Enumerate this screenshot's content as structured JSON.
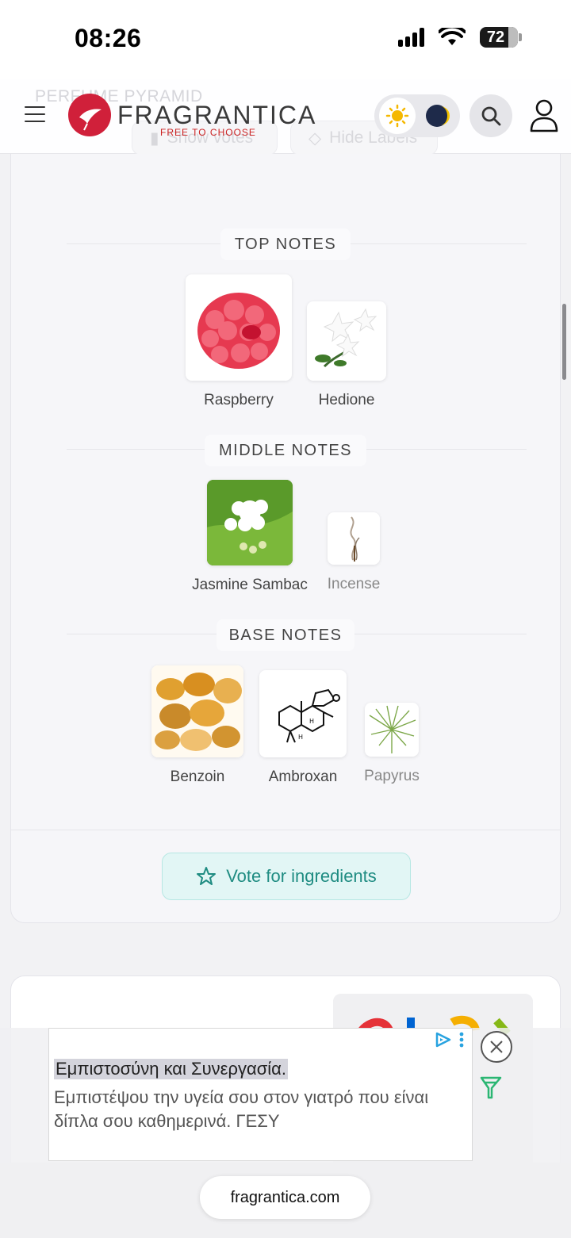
{
  "status_bar": {
    "time": "08:26",
    "battery": "72"
  },
  "header": {
    "ghost_title": "PERFUME PYRAMID",
    "ghost_show_votes": "Show votes",
    "ghost_hide_labels": "Hide Labels",
    "logo_text": "FRAGRANTICA",
    "logo_tagline": "FREE TO CHOOSE"
  },
  "pyramid": {
    "top": {
      "label": "TOP NOTES",
      "notes": [
        {
          "name": "Raspberry",
          "icon": "raspberry-icon"
        },
        {
          "name": "Hedione",
          "icon": "jasmine-flower-icon"
        }
      ]
    },
    "middle": {
      "label": "MIDDLE NOTES",
      "notes": [
        {
          "name": "Jasmine Sambac",
          "icon": "jasmine-sambac-icon"
        },
        {
          "name": "Incense",
          "icon": "incense-icon"
        }
      ]
    },
    "base": {
      "label": "BASE NOTES",
      "notes": [
        {
          "name": "Benzoin",
          "icon": "benzoin-resin-icon"
        },
        {
          "name": "Ambroxan",
          "icon": "molecule-icon"
        },
        {
          "name": "Papyrus",
          "icon": "papyrus-plant-icon"
        }
      ]
    }
  },
  "vote_button": {
    "label": "Vote for ingredients"
  },
  "ad": {
    "headline": "Εμπιστοσύνη και Συνεργασία.",
    "body": "Εμπιστέψου την υγεία σου στον γιατρό που είναι δίπλα σου καθημερινά. ΓΕΣΥ"
  },
  "browser": {
    "url": "fragrantica.com"
  },
  "colors": {
    "brand": "#d0203a",
    "accent_teal": "#1f8c82"
  }
}
